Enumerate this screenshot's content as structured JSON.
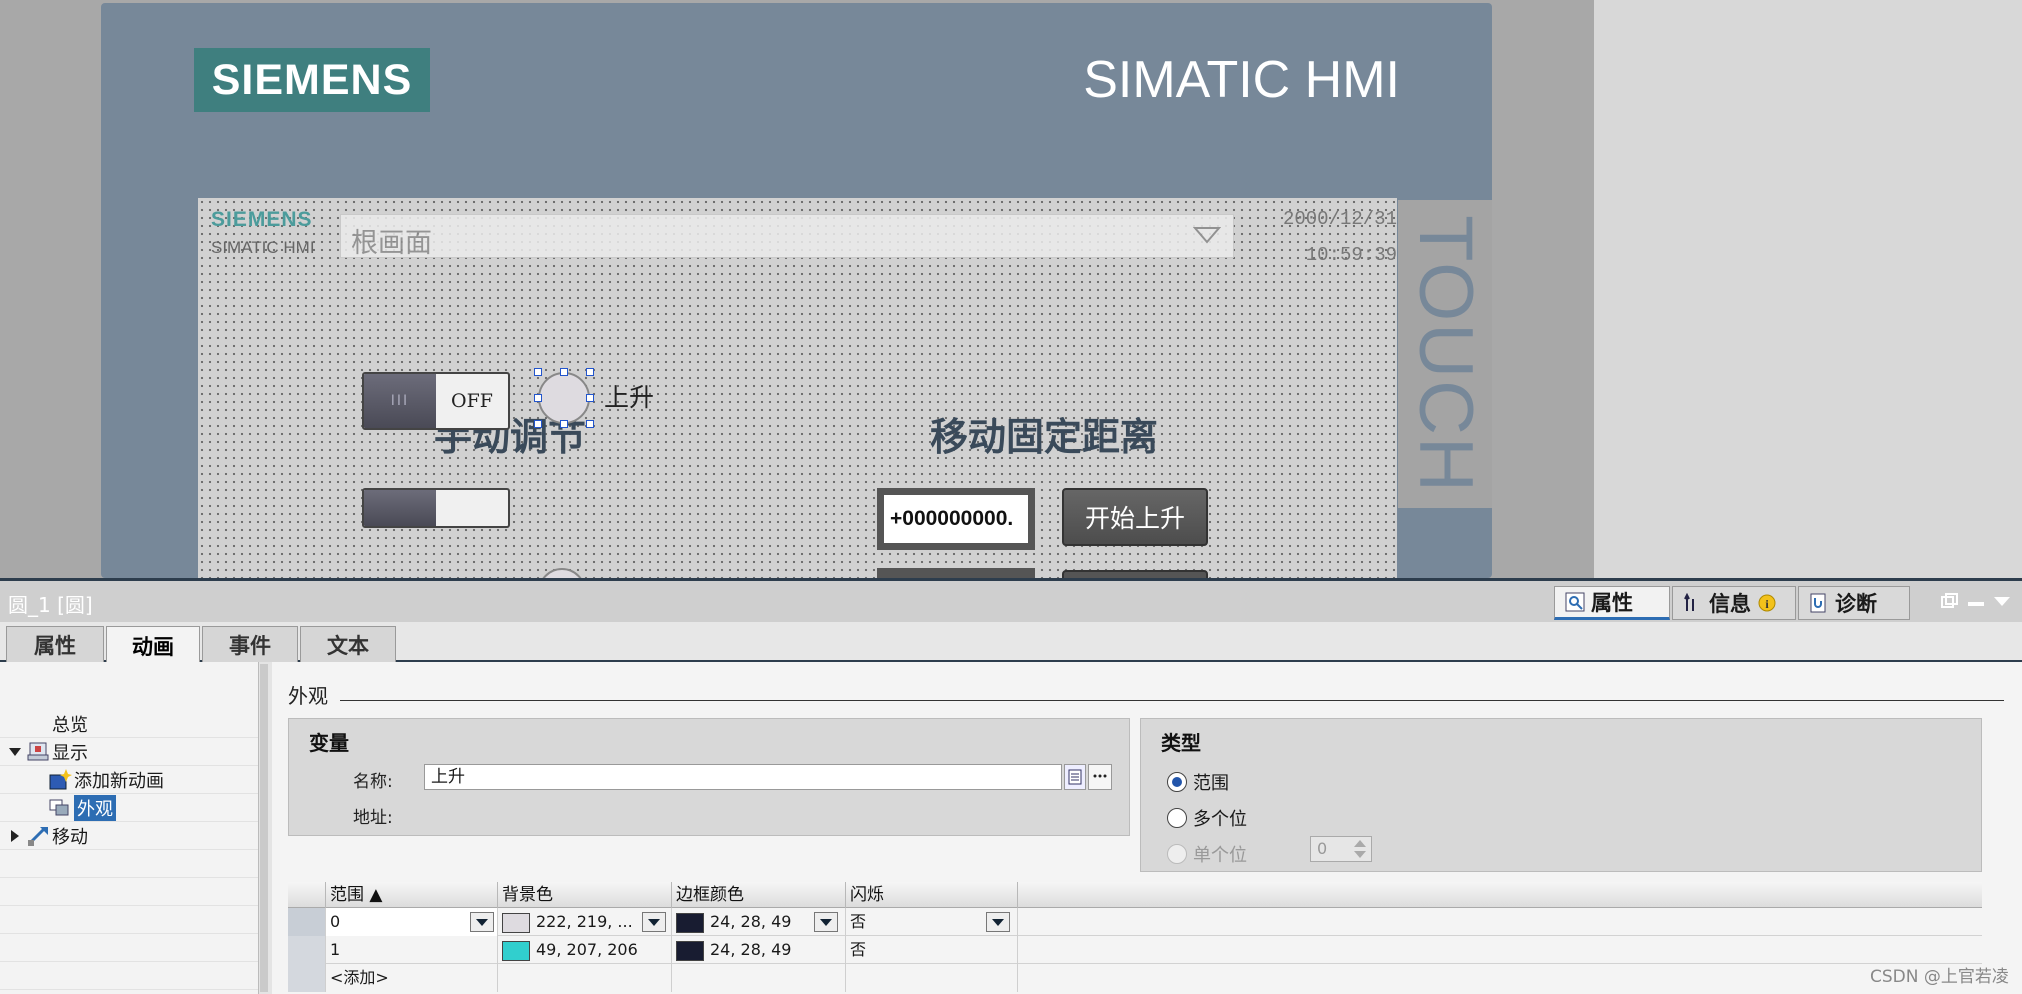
{
  "hmi": {
    "logo": "SIEMENS",
    "brand": "SIMATIC HMI",
    "side_label": "TOUCH",
    "mini_logo": "SIEMENS",
    "mini_brand": "SIMATIC HMI",
    "screen_select": "根画面",
    "date": "2000/12/31",
    "time": "10:59:39",
    "manual_title": "手动调节",
    "move_title": "移动固定距离",
    "toggle_off": "OFF",
    "toggle_bars": "III",
    "lamp_label": "上升",
    "numeric_value": "+000000000.",
    "start_button": "开始上升"
  },
  "inspector": {
    "title": "圆_1 [圆]",
    "right_tabs": [
      "属性",
      "信息",
      "诊断"
    ],
    "tabs": [
      "属性",
      "动画",
      "事件",
      "文本"
    ],
    "tree": [
      "总览",
      "显示",
      "添加新动画",
      "外观",
      "移动"
    ],
    "section": "外观",
    "variable": {
      "group_title": "变量",
      "name_label": "名称:",
      "name_value": "上升",
      "address_label": "地址:"
    },
    "type": {
      "group_title": "类型",
      "options": [
        "范围",
        "多个位",
        "单个位"
      ],
      "spin_value": "0"
    },
    "grid": {
      "headers": [
        "范围 ▲",
        "背景色",
        "边框颜色",
        "闪烁"
      ],
      "rows": [
        {
          "range": "0",
          "bg": "222, 219, ...",
          "bg_color": "#dedbe0",
          "border": "24, 28, 49",
          "border_color": "#181c31",
          "flash": "否"
        },
        {
          "range": "1",
          "bg": "49, 207, 206",
          "bg_color": "#31cfce",
          "border": "24, 28, 49",
          "border_color": "#181c31",
          "flash": "否"
        }
      ],
      "add_row": "<添加>"
    }
  },
  "watermark": "CSDN @上官若凌",
  "colors": {
    "accent": "#2d6db3",
    "panel": "#778899",
    "logo_bg": "#3f7f7f"
  }
}
